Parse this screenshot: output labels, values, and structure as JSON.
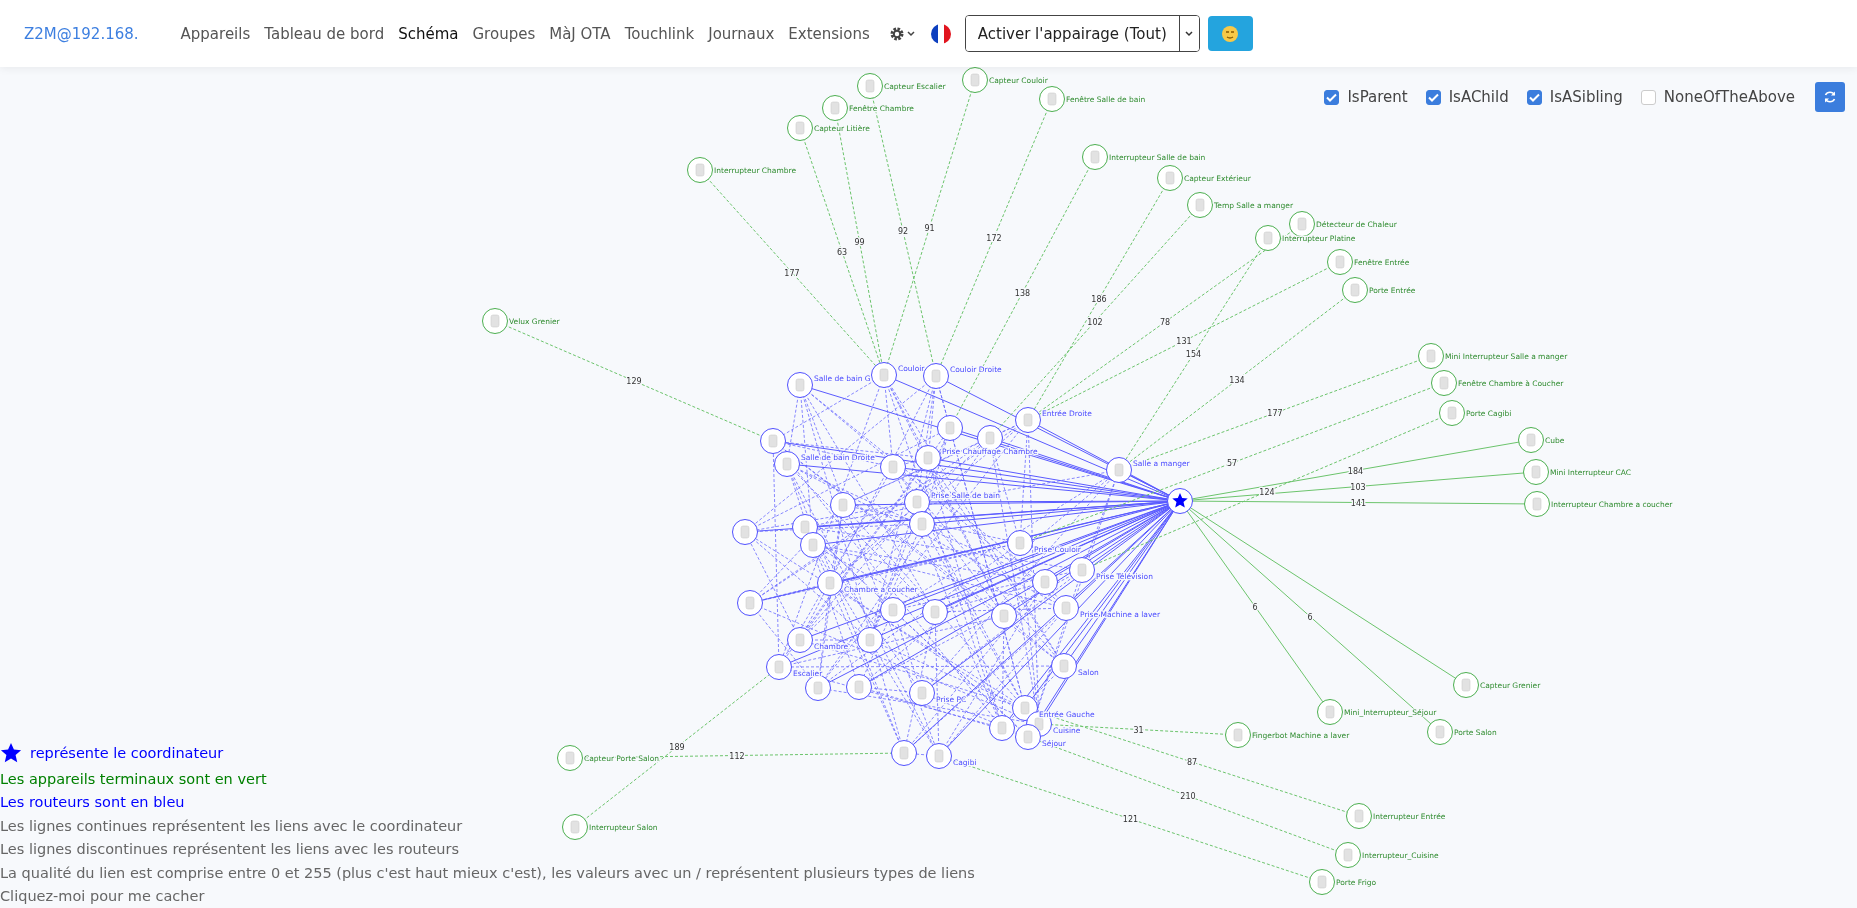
{
  "navbar": {
    "brand": "Z2M@192.168.",
    "links": [
      {
        "label": "Appareils",
        "selected": false
      },
      {
        "label": "Tableau de bord",
        "selected": false
      },
      {
        "label": "Schéma",
        "selected": true
      },
      {
        "label": "Groupes",
        "selected": false
      },
      {
        "label": "MàJ OTA",
        "selected": false
      },
      {
        "label": "Touchlink",
        "selected": false
      },
      {
        "label": "Journaux",
        "selected": false
      },
      {
        "label": "Extensions",
        "selected": false
      }
    ],
    "pairing_button": "Activer l'appairage (Tout)"
  },
  "filters": [
    {
      "label": "IsParent",
      "checked": true
    },
    {
      "label": "IsAChild",
      "checked": true
    },
    {
      "label": "IsASibling",
      "checked": true
    },
    {
      "label": "NoneOfTheAbove",
      "checked": false
    }
  ],
  "graph": {
    "routers": [
      {
        "name": "Salle de bain G"
      },
      {
        "name": "Couloir"
      },
      {
        "name": "Couloir Droite"
      },
      {
        "name": "Entrée Droite"
      },
      {
        "name": "Salle a manger"
      },
      {
        "name": "Salle de bain Droite"
      },
      {
        "name": "Prise Chauffage Chambre"
      },
      {
        "name": "Prise Salle de bain"
      },
      {
        "name": "Prise Couloir"
      },
      {
        "name": "Prise Télévision"
      },
      {
        "name": "Prise Machine a laver"
      },
      {
        "name": "Salon"
      },
      {
        "name": "Entrée Gauche"
      },
      {
        "name": "Cuisine"
      },
      {
        "name": "Séjour"
      },
      {
        "name": "Cagibi"
      },
      {
        "name": "Escalier"
      },
      {
        "name": "Chambre"
      },
      {
        "name": "Chambre a coucher"
      },
      {
        "name": "Prise PC"
      }
    ],
    "end_devices": [
      {
        "name": "Interrupteur Chambre",
        "link_quality": "177",
        "direct": false
      },
      {
        "name": "Capteur Litière",
        "link_quality": "63",
        "direct": false
      },
      {
        "name": "Fenêtre Chambre",
        "link_quality": "99",
        "direct": false
      },
      {
        "name": "Capteur Escalier",
        "link_quality": "92",
        "direct": false
      },
      {
        "name": "Capteur Couloir",
        "link_quality": "91",
        "direct": false
      },
      {
        "name": "Fenêtre Salle de bain",
        "link_quality": "172",
        "direct": false
      },
      {
        "name": "Interrupteur Salle de bain",
        "link_quality": "138",
        "direct": false
      },
      {
        "name": "Capteur Extérieur",
        "link_quality": "186",
        "direct": false
      },
      {
        "name": "Temp Salle a manger",
        "link_quality": "102",
        "direct": false
      },
      {
        "name": "Velux Grenier",
        "link_quality": "129",
        "direct": false
      },
      {
        "name": "Détecteur de Chaleur",
        "link_quality": "78",
        "direct": false
      },
      {
        "name": "Interrupteur Platine",
        "link_quality": "154",
        "direct": false
      },
      {
        "name": "Fenêtre Entrée",
        "link_quality": "131",
        "direct": false
      },
      {
        "name": "Porte Entrée",
        "link_quality": "134",
        "direct": false
      },
      {
        "name": "Mini Interrupteur Salle a manger",
        "link_quality": "177",
        "direct": false
      },
      {
        "name": "Fenêtre Chambre à Coucher",
        "link_quality": "57",
        "direct": false
      },
      {
        "name": "Porte Cagibi",
        "link_quality": "124",
        "direct": false
      },
      {
        "name": "Cube",
        "link_quality": "184",
        "direct": true
      },
      {
        "name": "Mini Interrupteur CAC",
        "link_quality": "103",
        "direct": true
      },
      {
        "name": "Interrupteur Chambre a coucher",
        "link_quality": "141",
        "direct": true
      },
      {
        "name": "Capteur Grenier",
        "direct": true
      },
      {
        "name": "Porte Salon",
        "link_quality": "6",
        "direct": true
      },
      {
        "name": "Mini_Interrupteur_Séjour",
        "link_quality": "6",
        "direct": true
      },
      {
        "name": "Fingerbot Machine a laver",
        "link_quality": "31",
        "direct": false
      },
      {
        "name": "Interrupteur Entrée",
        "link_quality": "87",
        "direct": false
      },
      {
        "name": "Interrupteur_Cuisine",
        "link_quality": "210",
        "direct": false
      },
      {
        "name": "Porte Frigo",
        "link_quality": "121",
        "direct": false
      },
      {
        "name": "Capteur Porte Salon",
        "link_quality": "112",
        "direct": false
      },
      {
        "name": "Interrupteur Salon",
        "link_quality": "189",
        "direct": false
      }
    ]
  },
  "legend": [
    {
      "kind": "coordinator",
      "text": "représente le coordinateur"
    },
    {
      "kind": "end_device",
      "text": "Les appareils terminaux sont en vert"
    },
    {
      "kind": "router",
      "text": "Les routeurs sont en bleu"
    },
    {
      "kind": "note",
      "text": "Les lignes continues représentent les liens avec le coordinateur"
    },
    {
      "kind": "note",
      "text": "Les lignes discontinues représentent les liens avec les routeurs"
    },
    {
      "kind": "note",
      "text": "La qualité du lien est comprise entre 0 et 255 (plus c'est haut mieux c'est), les valeurs avec un / représentent plusieurs types de liens"
    },
    {
      "kind": "action",
      "text": "Cliquez-moi pour me cacher"
    }
  ]
}
